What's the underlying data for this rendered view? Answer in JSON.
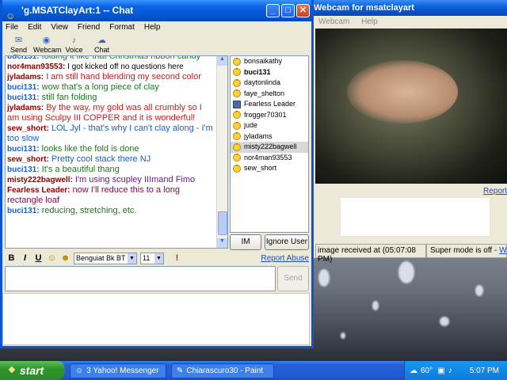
{
  "chat_window": {
    "title": "'g.MSATClayArt:1 -- Chat",
    "menu": [
      "File",
      "Edit",
      "View",
      "Friend",
      "Format",
      "Help"
    ],
    "toolbar": [
      {
        "label": "Send File",
        "icon": "send-file-icon"
      },
      {
        "label": "Webcam",
        "icon": "webcam-icon"
      },
      {
        "label": "Voice",
        "icon": "microphone-icon"
      },
      {
        "label": "Chat",
        "icon": "chat-icon"
      }
    ],
    "messages": [
      {
        "nick": "buci131:",
        "text": " folding it like that Christmas ribbon candy",
        "nick_color": "#1b5fbf",
        "text_color": "#1a7a1a"
      },
      {
        "nick": "nor4man93553:",
        "text": " I got kicked off no questions here",
        "nick_color": "#8b0000",
        "text_color": "#000000"
      },
      {
        "nick": "jyladams:",
        "text": " I am still hand blending my second color",
        "nick_color": "#8b0000",
        "text_color": "#c02020"
      },
      {
        "nick": "buci131:",
        "text": " wow that's a long piece of clay",
        "nick_color": "#1b5fbf",
        "text_color": "#1a7a1a"
      },
      {
        "nick": "buci131:",
        "text": " still fan folding",
        "nick_color": "#1b5fbf",
        "text_color": "#1a7a1a"
      },
      {
        "nick": "jyladams:",
        "text": " By the way, my gold was all crumbly so I am using Sculpy III COPPER and it is wonderful!",
        "nick_color": "#8b0000",
        "text_color": "#c02020"
      },
      {
        "nick": "sew_short:",
        "text": " LOL Jyl - that's why I can't clay along - I'm too slow",
        "nick_color": "#8b0000",
        "text_color": "#1b5fbf"
      },
      {
        "nick": "buci131:",
        "text": " looks like the fold is done",
        "nick_color": "#1b5fbf",
        "text_color": "#1a7a1a"
      },
      {
        "nick": "sew_short:",
        "text": " Pretty cool stack there NJ",
        "nick_color": "#8b0000",
        "text_color": "#1b5fbf"
      },
      {
        "nick": "buci131:",
        "text": " It's a beautiful thang",
        "nick_color": "#1b5fbf",
        "text_color": "#1a7a1a"
      },
      {
        "nick": "misty222bagwell:",
        "text": " I'm using scupley IIImand Fimo",
        "nick_color": "#8b0000",
        "text_color": "#6a1a8a"
      },
      {
        "nick": "Fearless Leader:",
        "text": " now I'll reduce this to a long rectangle loaf",
        "nick_color": "#8b0000",
        "text_color": "#7a0a4a"
      },
      {
        "nick": "buci131:",
        "text": " reducing, stretching, etc.",
        "nick_color": "#1b5fbf",
        "text_color": "#1a7a1a"
      }
    ],
    "users": [
      {
        "name": "bonsaikathy",
        "bold": false,
        "selected": false,
        "icon": "smiley-icon"
      },
      {
        "name": "buci131",
        "bold": true,
        "selected": false,
        "icon": "smiley-icon"
      },
      {
        "name": "daytonlinda",
        "bold": false,
        "selected": false,
        "icon": "smiley-icon"
      },
      {
        "name": "faye_shelton",
        "bold": false,
        "selected": false,
        "icon": "smiley-icon"
      },
      {
        "name": "Fearless Leader",
        "bold": false,
        "selected": false,
        "icon": "webcam-user-icon"
      },
      {
        "name": "frogger70301",
        "bold": false,
        "selected": false,
        "icon": "smiley-icon"
      },
      {
        "name": "jude",
        "bold": false,
        "selected": false,
        "icon": "smiley-icon"
      },
      {
        "name": "jyladams",
        "bold": false,
        "selected": false,
        "icon": "smiley-icon"
      },
      {
        "name": "misty222bagwell",
        "bold": false,
        "selected": true,
        "icon": "smiley-icon"
      },
      {
        "name": "nor4man93553",
        "bold": false,
        "selected": false,
        "icon": "smiley-icon"
      },
      {
        "name": "sew_short",
        "bold": false,
        "selected": false,
        "icon": "smiley-icon"
      }
    ],
    "im_button": "IM",
    "ignore_button": "Ignore User",
    "format": {
      "bold": "B",
      "italic": "I",
      "underline": "U",
      "font": "Benguiat Bk BT",
      "size": "11",
      "report": "Report Abuse"
    },
    "send_button": "Send"
  },
  "webcam_window": {
    "title": "Webcam for msatclayart",
    "menu": [
      "Webcam",
      "Help"
    ],
    "report": "Report",
    "status_image": "image received at (05:07:08 PM)",
    "status_mode": "Super mode is off - ",
    "status_link": "What"
  },
  "taskbar": {
    "start": "start",
    "tasks": [
      {
        "label": "3 Yahoo! Messenger",
        "icon": "yahoo-messenger-icon"
      },
      {
        "label": "Chiarascuro30 - Paint",
        "icon": "paint-icon"
      }
    ],
    "temperature": "60°",
    "clock": "5:07 PM"
  },
  "colors": {
    "xp_blue": "#0a55d8",
    "start_green": "#2e962a"
  }
}
